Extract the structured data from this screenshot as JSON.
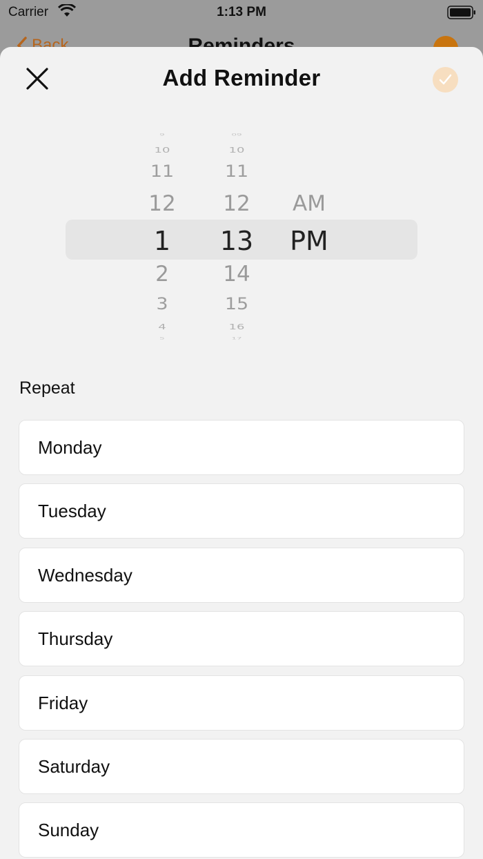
{
  "status_bar": {
    "carrier": "Carrier",
    "time": "1:13 PM"
  },
  "background_page": {
    "back_label": "Back",
    "title": "Reminders"
  },
  "sheet": {
    "title": "Add Reminder",
    "close_icon": "close-icon",
    "confirm_icon": "checkmark-icon"
  },
  "time_picker": {
    "hours": [
      "9",
      "10",
      "11",
      "12",
      "1",
      "2",
      "3",
      "4",
      "5"
    ],
    "minutes": [
      "09",
      "10",
      "11",
      "12",
      "13",
      "14",
      "15",
      "16",
      "17"
    ],
    "period": [
      "AM",
      "PM"
    ],
    "selected": {
      "hour": "1",
      "minute": "13",
      "period": "PM"
    }
  },
  "repeat": {
    "label": "Repeat",
    "days": [
      "Monday",
      "Tuesday",
      "Wednesday",
      "Thursday",
      "Friday",
      "Saturday",
      "Sunday"
    ]
  },
  "colors": {
    "accent": "#c8740f",
    "confirm_bg": "#f7dec0",
    "sheet_bg": "#f2f2f2"
  }
}
